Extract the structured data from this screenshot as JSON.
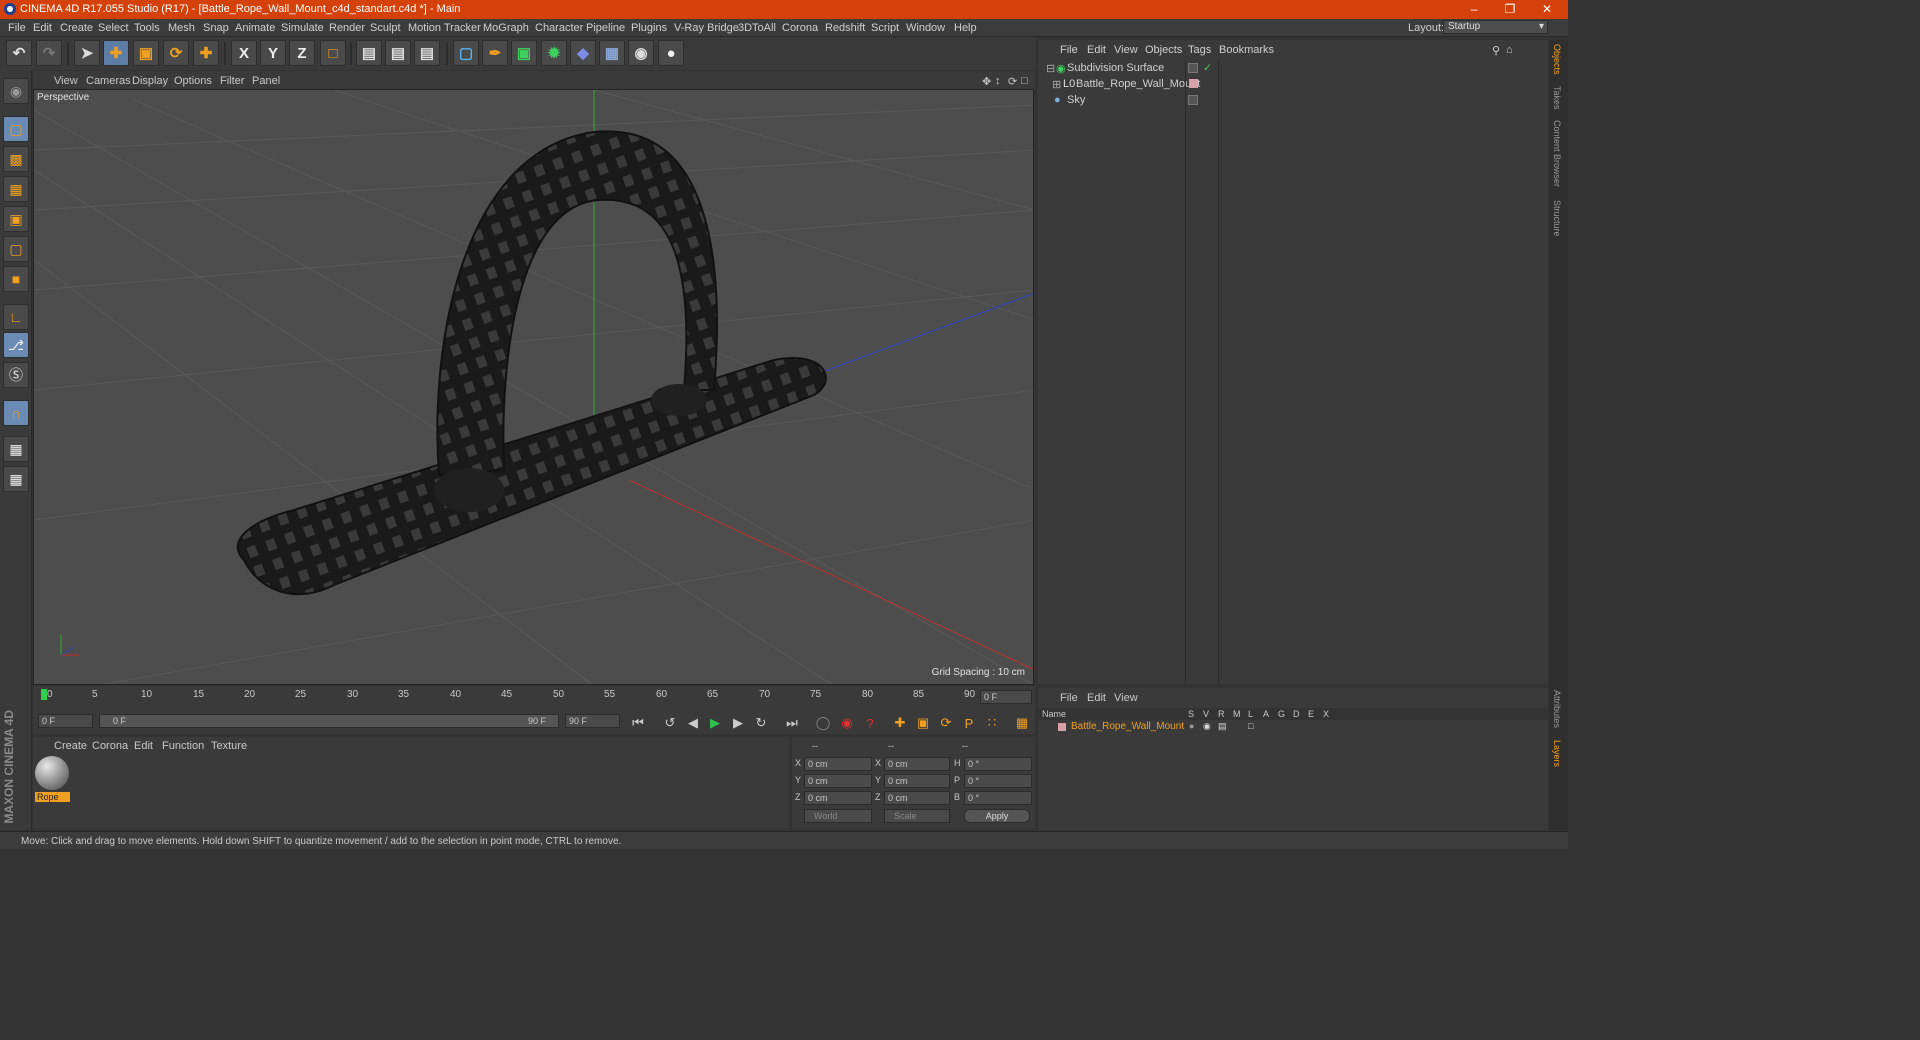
{
  "window": {
    "title": "CINEMA 4D R17.055 Studio (R17) - [Battle_Rope_Wall_Mount_c4d_standart.c4d *] - Main"
  },
  "menu": [
    "File",
    "Edit",
    "Create",
    "Select",
    "Tools",
    "Mesh",
    "Snap",
    "Animate",
    "Simulate",
    "Render",
    "Sculpt",
    "Motion Tracker",
    "MoGraph",
    "Character",
    "Pipeline",
    "Plugins",
    "V-Ray Bridge",
    "3DToAll",
    "Corona",
    "Redshift",
    "Script",
    "Window",
    "Help"
  ],
  "layout": {
    "label": "Layout:",
    "value": "Startup"
  },
  "toolbar": {
    "axis_x": "X",
    "axis_y": "Y",
    "axis_z": "Z"
  },
  "viewport_menu": [
    "View",
    "Cameras",
    "Display",
    "Options",
    "Filter",
    "Panel"
  ],
  "viewport": {
    "name": "Perspective",
    "grid_spacing": "Grid Spacing : 10 cm"
  },
  "timeline": {
    "ticks": [
      "0",
      "5",
      "10",
      "15",
      "20",
      "25",
      "30",
      "35",
      "40",
      "45",
      "50",
      "55",
      "60",
      "65",
      "70",
      "75",
      "80",
      "85",
      "90"
    ],
    "frame_field": "0 F",
    "start": "0 F",
    "range_start": "0 F",
    "range_end": "90 F",
    "end": "90 F"
  },
  "material_menu": [
    "Create",
    "Corona",
    "Edit",
    "Function",
    "Texture"
  ],
  "material": {
    "name": "Rope"
  },
  "coords": {
    "headers": [
      "--",
      "--",
      "--"
    ],
    "rows": [
      {
        "a": "X",
        "av": "0 cm",
        "b": "X",
        "bv": "0 cm",
        "c": "H",
        "cv": "0 °"
      },
      {
        "a": "Y",
        "av": "0 cm",
        "b": "Y",
        "bv": "0 cm",
        "c": "P",
        "cv": "0 °"
      },
      {
        "a": "Z",
        "av": "0 cm",
        "b": "Z",
        "bv": "0 cm",
        "c": "B",
        "cv": "0 °"
      }
    ],
    "space": "World",
    "mode": "Scale",
    "apply": "Apply"
  },
  "objects_menu": [
    "File",
    "Edit",
    "View",
    "Objects",
    "Tags",
    "Bookmarks"
  ],
  "objects": [
    {
      "name": "Subdivision Surface"
    },
    {
      "name": "Battle_Rope_Wall_Mount"
    },
    {
      "name": "Sky"
    }
  ],
  "layers_menu": [
    "File",
    "Edit",
    "View"
  ],
  "layers": {
    "name_header": "Name",
    "cols": [
      "S",
      "V",
      "R",
      "M",
      "L",
      "A",
      "G",
      "D",
      "E",
      "X"
    ],
    "row": "Battle_Rope_Wall_Mount"
  },
  "side_tabs": [
    "Objects",
    "Takes",
    "Content Browser",
    "Structure"
  ],
  "side_tabs_bottom": [
    "Attributes",
    "Layers"
  ],
  "brand": "MAXON CINEMA 4D",
  "status": "Move: Click and drag to move elements. Hold down SHIFT to quantize movement / add to the selection in point mode, CTRL to remove.",
  "colors": {
    "titlebar": "#d4410b",
    "highlight": "#f0a020",
    "axis_x": "#c03030",
    "axis_y": "#30b030",
    "axis_z": "#3040c0"
  }
}
